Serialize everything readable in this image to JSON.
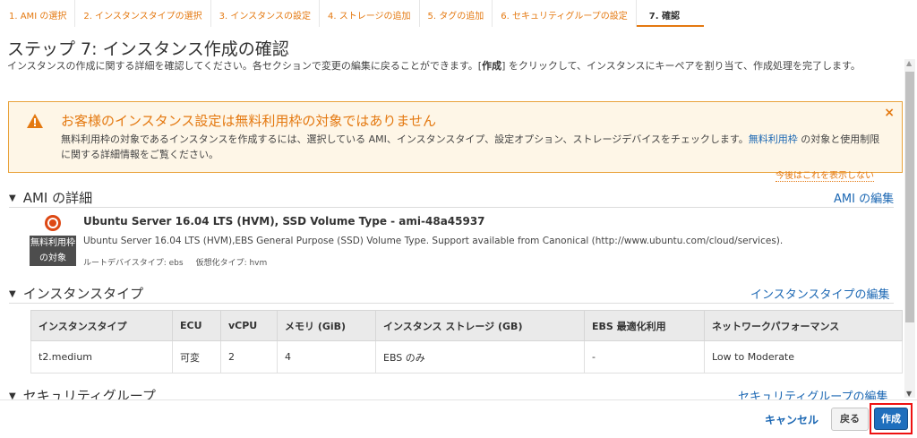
{
  "tabs": [
    {
      "label": "1. AMI の選択"
    },
    {
      "label": "2. インスタンスタイプの選択"
    },
    {
      "label": "3. インスタンスの設定"
    },
    {
      "label": "4. ストレージの追加"
    },
    {
      "label": "5. タグの追加"
    },
    {
      "label": "6. セキュリティグループの設定"
    },
    {
      "label": "7. 確認"
    }
  ],
  "page": {
    "title": "ステップ 7: インスタンス作成の確認",
    "desc_before": "インスタンスの作成に関する詳細を確認してください。各セクションで変更の編集に戻ることができます。[",
    "desc_bold": "作成",
    "desc_after": "] をクリックして、インスタンスにキーペアを割り当て、作成処理を完了します。"
  },
  "warning": {
    "title": "お客様のインスタンス設定は無料利用枠の対象ではありません",
    "body_before": "無料利用枠の対象であるインスタンスを作成するには、選択している AMI、インスタンスタイプ、設定オプション、ストレージデバイスをチェックします。",
    "body_link": "無料利用枠",
    "body_after": " の対象と使用制限に関する詳細情報をご覧ください。",
    "close": "×",
    "dont_show": "今後はこれを表示しない"
  },
  "ami": {
    "heading": "AMI の詳細",
    "edit": "AMI の編集",
    "name": "Ubuntu Server 16.04 LTS (HVM), SSD Volume Type - ami-48a45937",
    "badge_line1": "無料利用枠",
    "badge_line2": "の対象",
    "description": "Ubuntu Server 16.04 LTS (HVM),EBS General Purpose (SSD) Volume Type. Support available from Canonical (http://www.ubuntu.com/cloud/services).",
    "root_device": "ルートデバイスタイプ: ebs",
    "virtualization": "仮想化タイプ: hvm"
  },
  "instance_type": {
    "heading": "インスタンスタイプ",
    "edit": "インスタンスタイプの編集",
    "columns": [
      "インスタンスタイプ",
      "ECU",
      "vCPU",
      "メモリ (GiB)",
      "インスタンス ストレージ (GB)",
      "EBS 最適化利用",
      "ネットワークパフォーマンス"
    ],
    "row": [
      "t2.medium",
      "可変",
      "2",
      "4",
      "EBS のみ",
      "-",
      "Low to Moderate"
    ]
  },
  "security_group": {
    "heading": "セキュリティグループ",
    "edit": "セキュリティグループの編集"
  },
  "footer": {
    "cancel": "キャンセル",
    "back": "戻る",
    "create": "作成"
  },
  "colors": {
    "accent": "#e47911",
    "link": "#1b67b3",
    "primary_button": "#1f6fbd",
    "highlight_border": "#ee1111"
  }
}
